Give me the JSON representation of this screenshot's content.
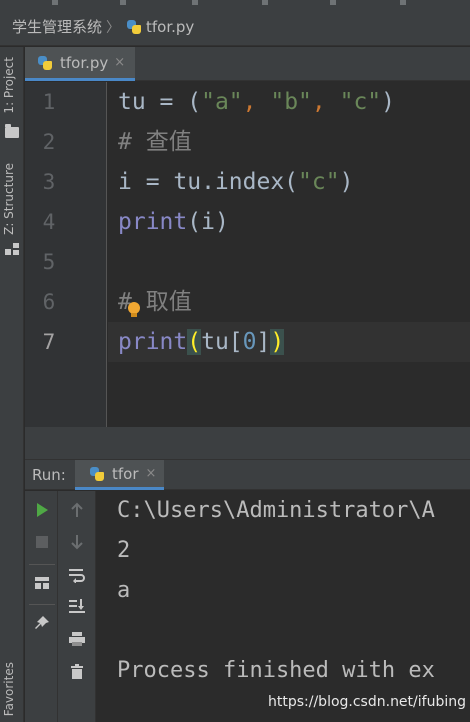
{
  "breadcrumb": {
    "project": "学生管理系统",
    "file": "tfor.py"
  },
  "side_tools": {
    "project": "1: Project",
    "structure": "Z: Structure",
    "favorites": "Favorites"
  },
  "editor": {
    "tab_label": "tfor.py",
    "close_glyph": "×",
    "line_numbers": [
      "1",
      "2",
      "3",
      "4",
      "5",
      "6",
      "7"
    ],
    "lines": {
      "l1": {
        "v": "tu",
        "eq": " = (",
        "a": "\"a\"",
        "c1": ", ",
        "b": "\"b\"",
        "c2": ", ",
        "c": "\"c\"",
        "end": ")"
      },
      "l2": {
        "comment": "# 查值"
      },
      "l3": {
        "lhs": "i = tu.index(",
        "arg": "\"c\"",
        "end": ")"
      },
      "l4": {
        "fn": "print",
        "rest": "(i)"
      },
      "l5": {},
      "l6": {
        "hash": "#",
        "text": " 取值"
      },
      "l7": {
        "fn": "print",
        "open": "(",
        "obj": "tu[",
        "idx": "0",
        "close_bracket": "]",
        "close": ")"
      }
    }
  },
  "run": {
    "label": "Run:",
    "tab_label": "tfor",
    "close_glyph": "×",
    "output": [
      "C:\\Users\\Administrator\\A",
      "2",
      "a",
      "",
      "Process finished with ex"
    ]
  },
  "watermark": "https://blog.csdn.net/ifubing",
  "colors": {
    "accent": "#4a88c7",
    "string": "#6a8759",
    "comment": "#808080",
    "builtin": "#8888c6",
    "number": "#6897bb",
    "run_green": "#4fa845"
  }
}
